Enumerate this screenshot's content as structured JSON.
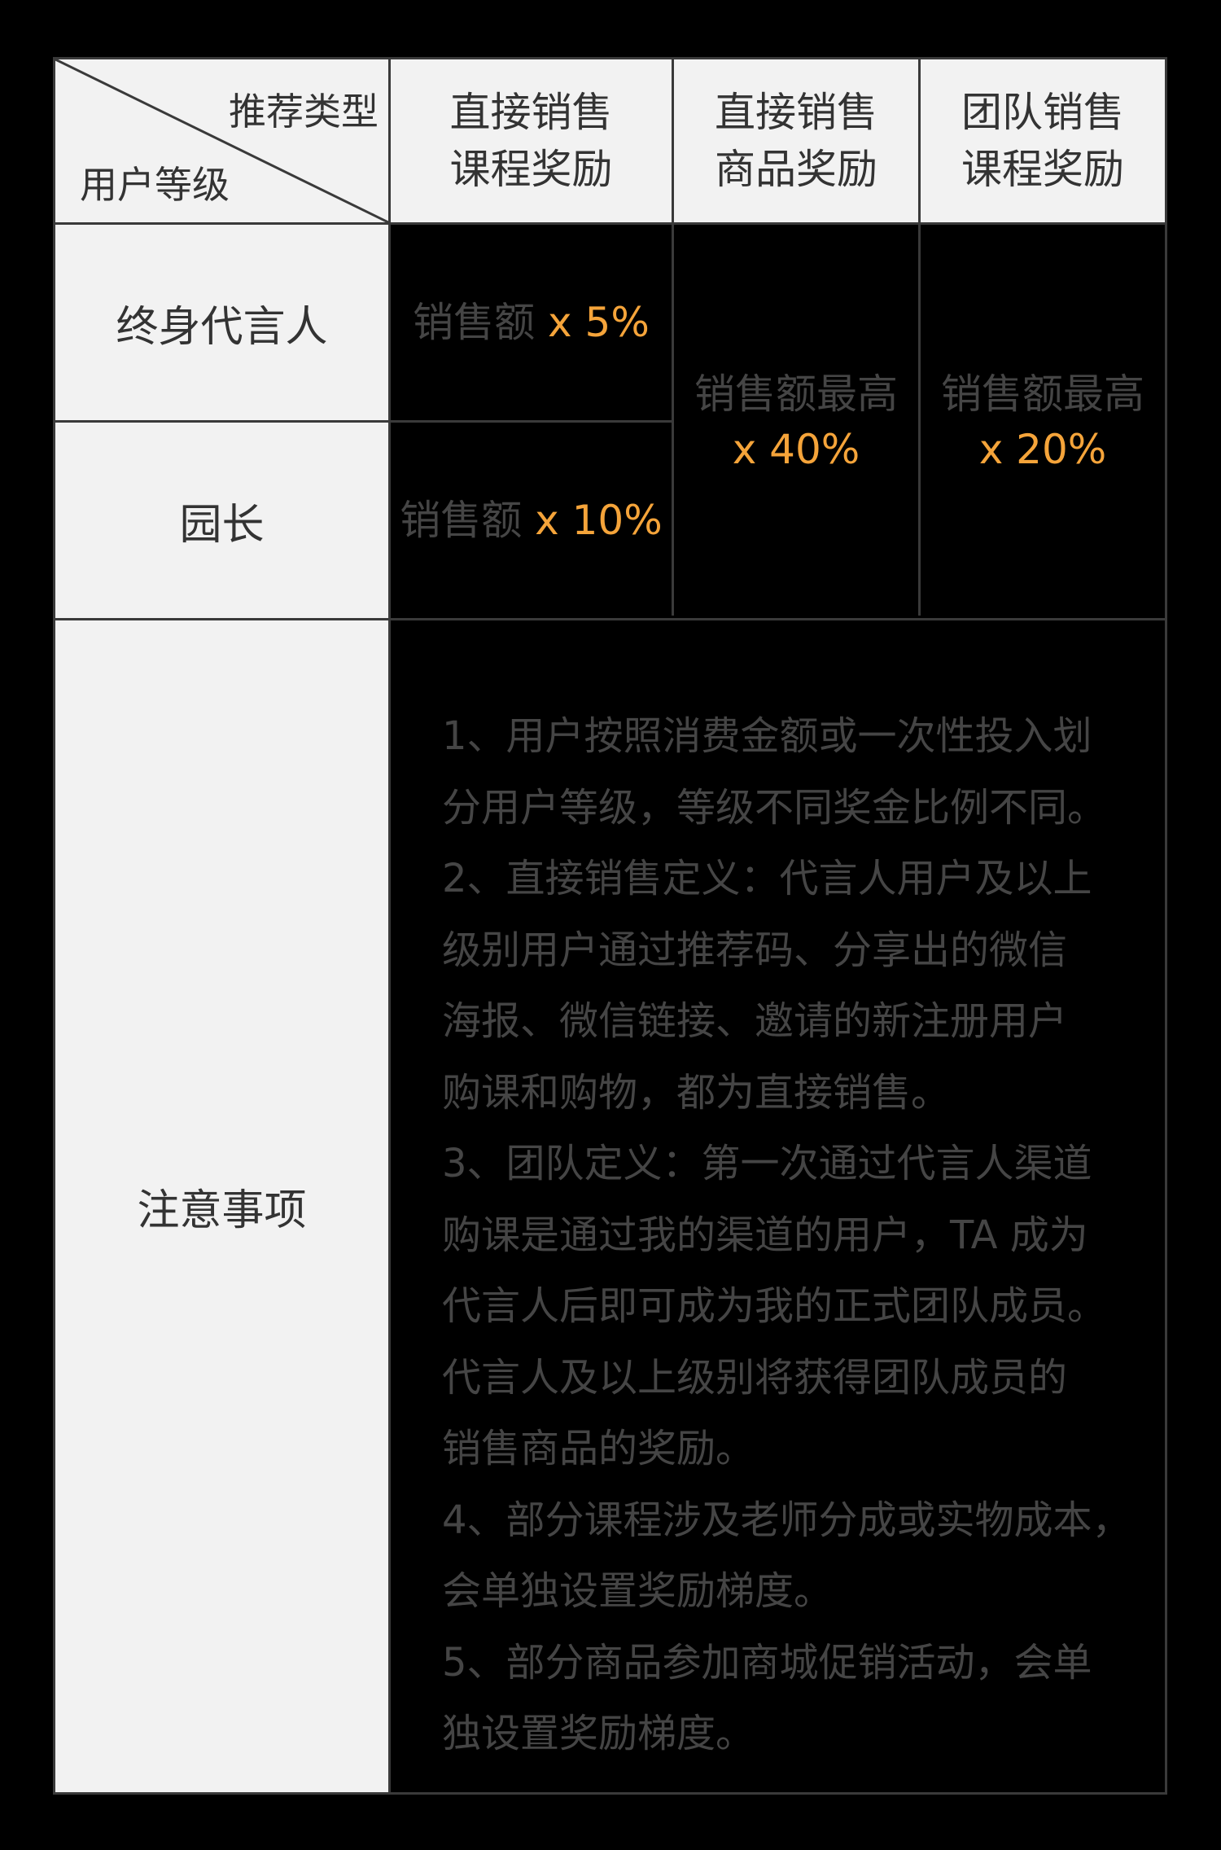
{
  "header": {
    "diagonal_top": "推荐类型",
    "diagonal_bottom": "用户等级",
    "col1": [
      "直接销售",
      "课程奖励"
    ],
    "col2": [
      "直接销售",
      "商品奖励"
    ],
    "col3": [
      "团队销售",
      "课程奖励"
    ]
  },
  "rows": {
    "row1_label": "终身代言人",
    "row2_label": "园长",
    "notes_label": "注意事项"
  },
  "values": {
    "row1_col1_prefix": "销售额",
    "row1_col1_rate": "x 5%",
    "row2_col1_prefix": "销售额",
    "row2_col1_rate": "x 10%",
    "col2_prefix": "销售额最高",
    "col2_rate": "x 40%",
    "col3_prefix": "销售额最高",
    "col3_rate": "x 20%"
  },
  "notes": [
    "1、用户按照消费金额或一次性投入划",
    "分用户等级，等级不同奖金比例不同。",
    "2、直接销售定义：代言人用户及以上",
    "级别用户通过推荐码、分享出的微信",
    "海报、微信链接、邀请的新注册用户",
    "购课和购物，都为直接销售。",
    "3、团队定义：第一次通过代言人渠道",
    "购课是通过我的渠道的用户，TA 成为",
    "代言人后即可成为我的正式团队成员。",
    "代言人及以上级别将获得团队成员的",
    "销售商品的奖励。",
    "4、部分课程涉及老师分成或实物成本，",
    "会单独设置奖励梯度。",
    "5、部分商品参加商城促销活动，会单",
    "独设置奖励梯度。"
  ],
  "colors": {
    "accent": "#f5a43a",
    "header_bg": "#f2f2f2",
    "grid": "#3a3a3a"
  }
}
